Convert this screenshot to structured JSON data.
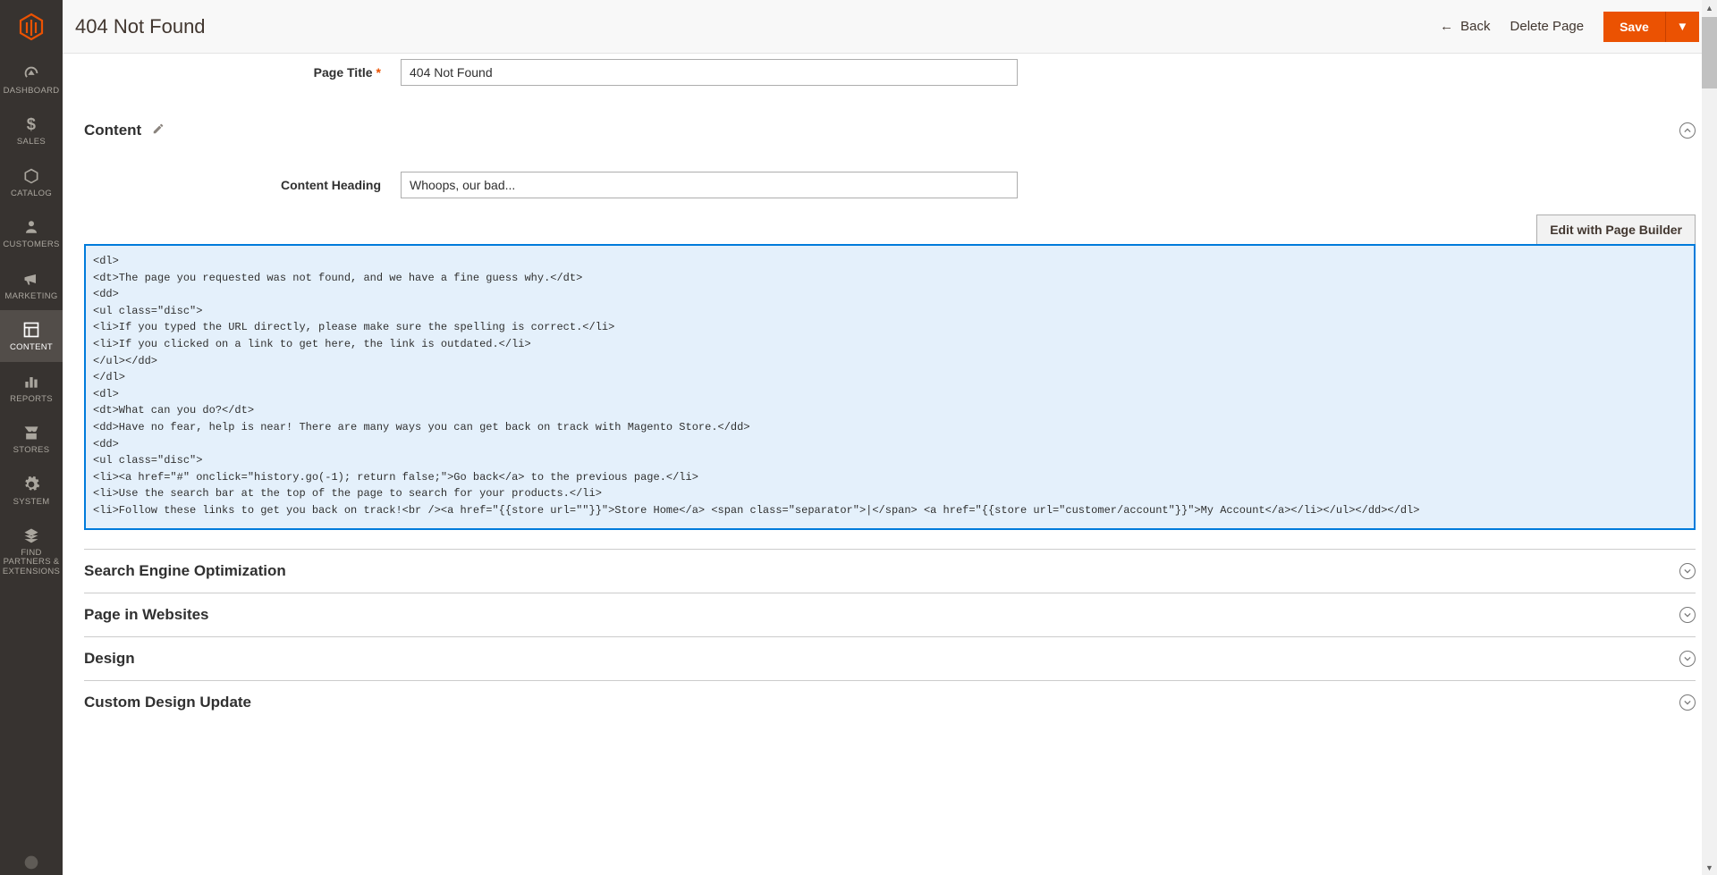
{
  "header": {
    "title": "404 Not Found",
    "back_label": "Back",
    "delete_label": "Delete Page",
    "save_label": "Save"
  },
  "sidebar": {
    "items": [
      {
        "label": "DASHBOARD"
      },
      {
        "label": "SALES"
      },
      {
        "label": "CATALOG"
      },
      {
        "label": "CUSTOMERS"
      },
      {
        "label": "MARKETING"
      },
      {
        "label": "CONTENT"
      },
      {
        "label": "REPORTS"
      },
      {
        "label": "STORES"
      },
      {
        "label": "SYSTEM"
      },
      {
        "label": "FIND PARTNERS & EXTENSIONS"
      }
    ]
  },
  "form": {
    "page_title_label": "Page Title",
    "page_title_value": "404 Not Found",
    "content_section_label": "Content",
    "content_heading_label": "Content Heading",
    "content_heading_value": "Whoops, our bad...",
    "edit_builder_label": "Edit with Page Builder",
    "content_html": "<dl>\n<dt>The page you requested was not found, and we have a fine guess why.</dt>\n<dd>\n<ul class=\"disc\">\n<li>If you typed the URL directly, please make sure the spelling is correct.</li>\n<li>If you clicked on a link to get here, the link is outdated.</li>\n</ul></dd>\n</dl>\n<dl>\n<dt>What can you do?</dt>\n<dd>Have no fear, help is near! There are many ways you can get back on track with Magento Store.</dd>\n<dd>\n<ul class=\"disc\">\n<li><a href=\"#\" onclick=\"history.go(-1); return false;\">Go back</a> to the previous page.</li>\n<li>Use the search bar at the top of the page to search for your products.</li>\n<li>Follow these links to get you back on track!<br /><a href=\"{{store url=\"\"}}\">Store Home</a> <span class=\"separator\">|</span> <a href=\"{{store url=\"customer/account\"}}\">My Account</a></li></ul></dd></dl>"
  },
  "sections": [
    {
      "label": "Search Engine Optimization"
    },
    {
      "label": "Page in Websites"
    },
    {
      "label": "Design"
    },
    {
      "label": "Custom Design Update"
    }
  ]
}
